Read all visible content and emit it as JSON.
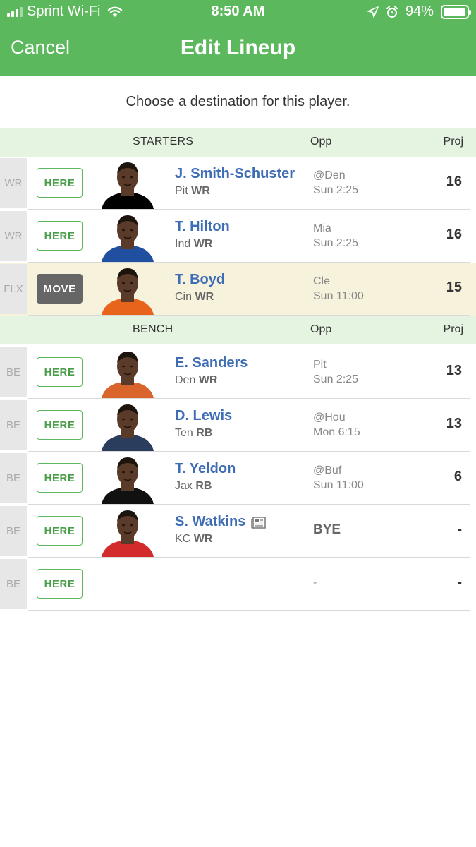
{
  "status_bar": {
    "carrier": "Sprint Wi-Fi",
    "time": "8:50 AM",
    "battery": "94%",
    "battery_level": 0.94,
    "signal_icon": "cellular-signal-icon",
    "wifi_icon": "wifi-icon",
    "location_icon": "location-arrow-icon",
    "alarm_icon": "alarm-clock-icon"
  },
  "nav": {
    "cancel_label": "Cancel",
    "title": "Edit Lineup",
    "background_color": "#5cb85c"
  },
  "instruction": "Choose a destination for this player.",
  "starters": {
    "header": {
      "label": "STARTERS",
      "opp": "Opp",
      "proj": "Proj"
    },
    "rows": [
      {
        "slot": "WR",
        "action": "HERE",
        "name": "J. Smith-Schuster",
        "team": "Pit",
        "pos": "WR",
        "opp": "@Den",
        "time": "Sun 2:25",
        "proj": "16",
        "jersey": "#000000"
      },
      {
        "slot": "WR",
        "action": "HERE",
        "name": "T. Hilton",
        "team": "Ind",
        "pos": "WR",
        "opp": "Mia",
        "time": "Sun 2:25",
        "proj": "16",
        "jersey": "#1f4f9e"
      },
      {
        "slot": "FLX",
        "action": "MOVE",
        "name": "T. Boyd",
        "team": "Cin",
        "pos": "WR",
        "opp": "Cle",
        "time": "Sun 11:00",
        "proj": "15",
        "jersey": "#e8641b"
      }
    ]
  },
  "bench": {
    "header": {
      "label": "BENCH",
      "opp": "Opp",
      "proj": "Proj"
    },
    "rows": [
      {
        "slot": "BE",
        "action": "HERE",
        "name": "E. Sanders",
        "team": "Den",
        "pos": "WR",
        "opp": "Pit",
        "time": "Sun 2:25",
        "proj": "13",
        "jersey": "#d9652c"
      },
      {
        "slot": "BE",
        "action": "HERE",
        "name": "D. Lewis",
        "team": "Ten",
        "pos": "RB",
        "opp": "@Hou",
        "time": "Mon 6:15",
        "proj": "13",
        "jersey": "#2a3d5c"
      },
      {
        "slot": "BE",
        "action": "HERE",
        "name": "T. Yeldon",
        "team": "Jax",
        "pos": "RB",
        "opp": "@Buf",
        "time": "Sun 11:00",
        "proj": "6",
        "jersey": "#111111"
      },
      {
        "slot": "BE",
        "action": "HERE",
        "name": "S. Watkins",
        "team": "KC",
        "pos": "WR",
        "opp": "BYE",
        "time": "",
        "proj": "-",
        "jersey": "#d32b2b",
        "has_news": true
      },
      {
        "slot": "BE",
        "action": "HERE",
        "name": "",
        "team": "",
        "pos": "",
        "opp": "-",
        "time": "",
        "proj": "-",
        "empty": true
      }
    ]
  },
  "colors": {
    "accent": "#5cb85c",
    "link": "#3e6db5",
    "section_bg": "#e5f3e1",
    "highlight_row": "#f7f2dc"
  }
}
